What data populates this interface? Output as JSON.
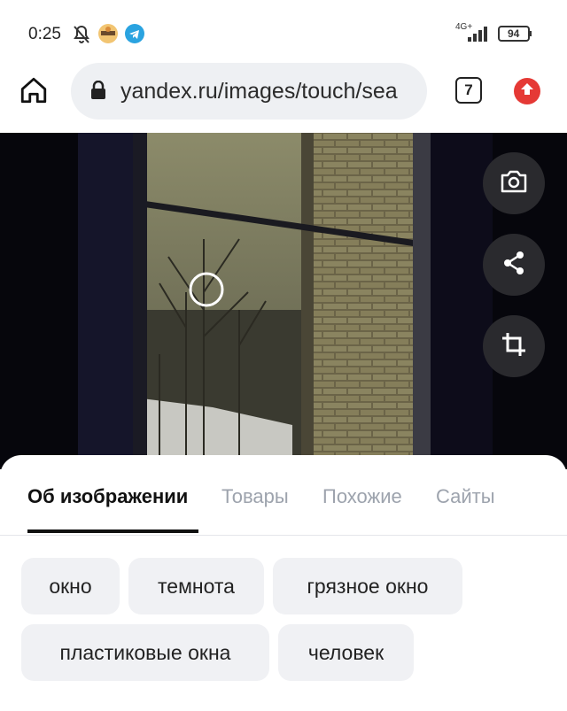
{
  "status": {
    "time": "0:25",
    "network": "4G+",
    "battery": "94"
  },
  "browser": {
    "url": "yandex.ru/images/touch/sea",
    "tab_count": "7"
  },
  "tabs": [
    {
      "label": "Об изображении",
      "active": true
    },
    {
      "label": "Товары",
      "active": false
    },
    {
      "label": "Похожие",
      "active": false
    },
    {
      "label": "Сайты",
      "active": false
    }
  ],
  "tags": [
    "окно",
    "темнота",
    "грязное окно",
    "пластиковые окна",
    "человек"
  ],
  "icons": {
    "camera": "camera-search-icon",
    "share": "share-icon",
    "crop": "crop-icon",
    "home": "home-icon",
    "lock": "lock-icon",
    "update": "update-arrow-icon"
  },
  "colors": {
    "update_badge": "#e53935",
    "telegram": "#2aa3e0"
  }
}
